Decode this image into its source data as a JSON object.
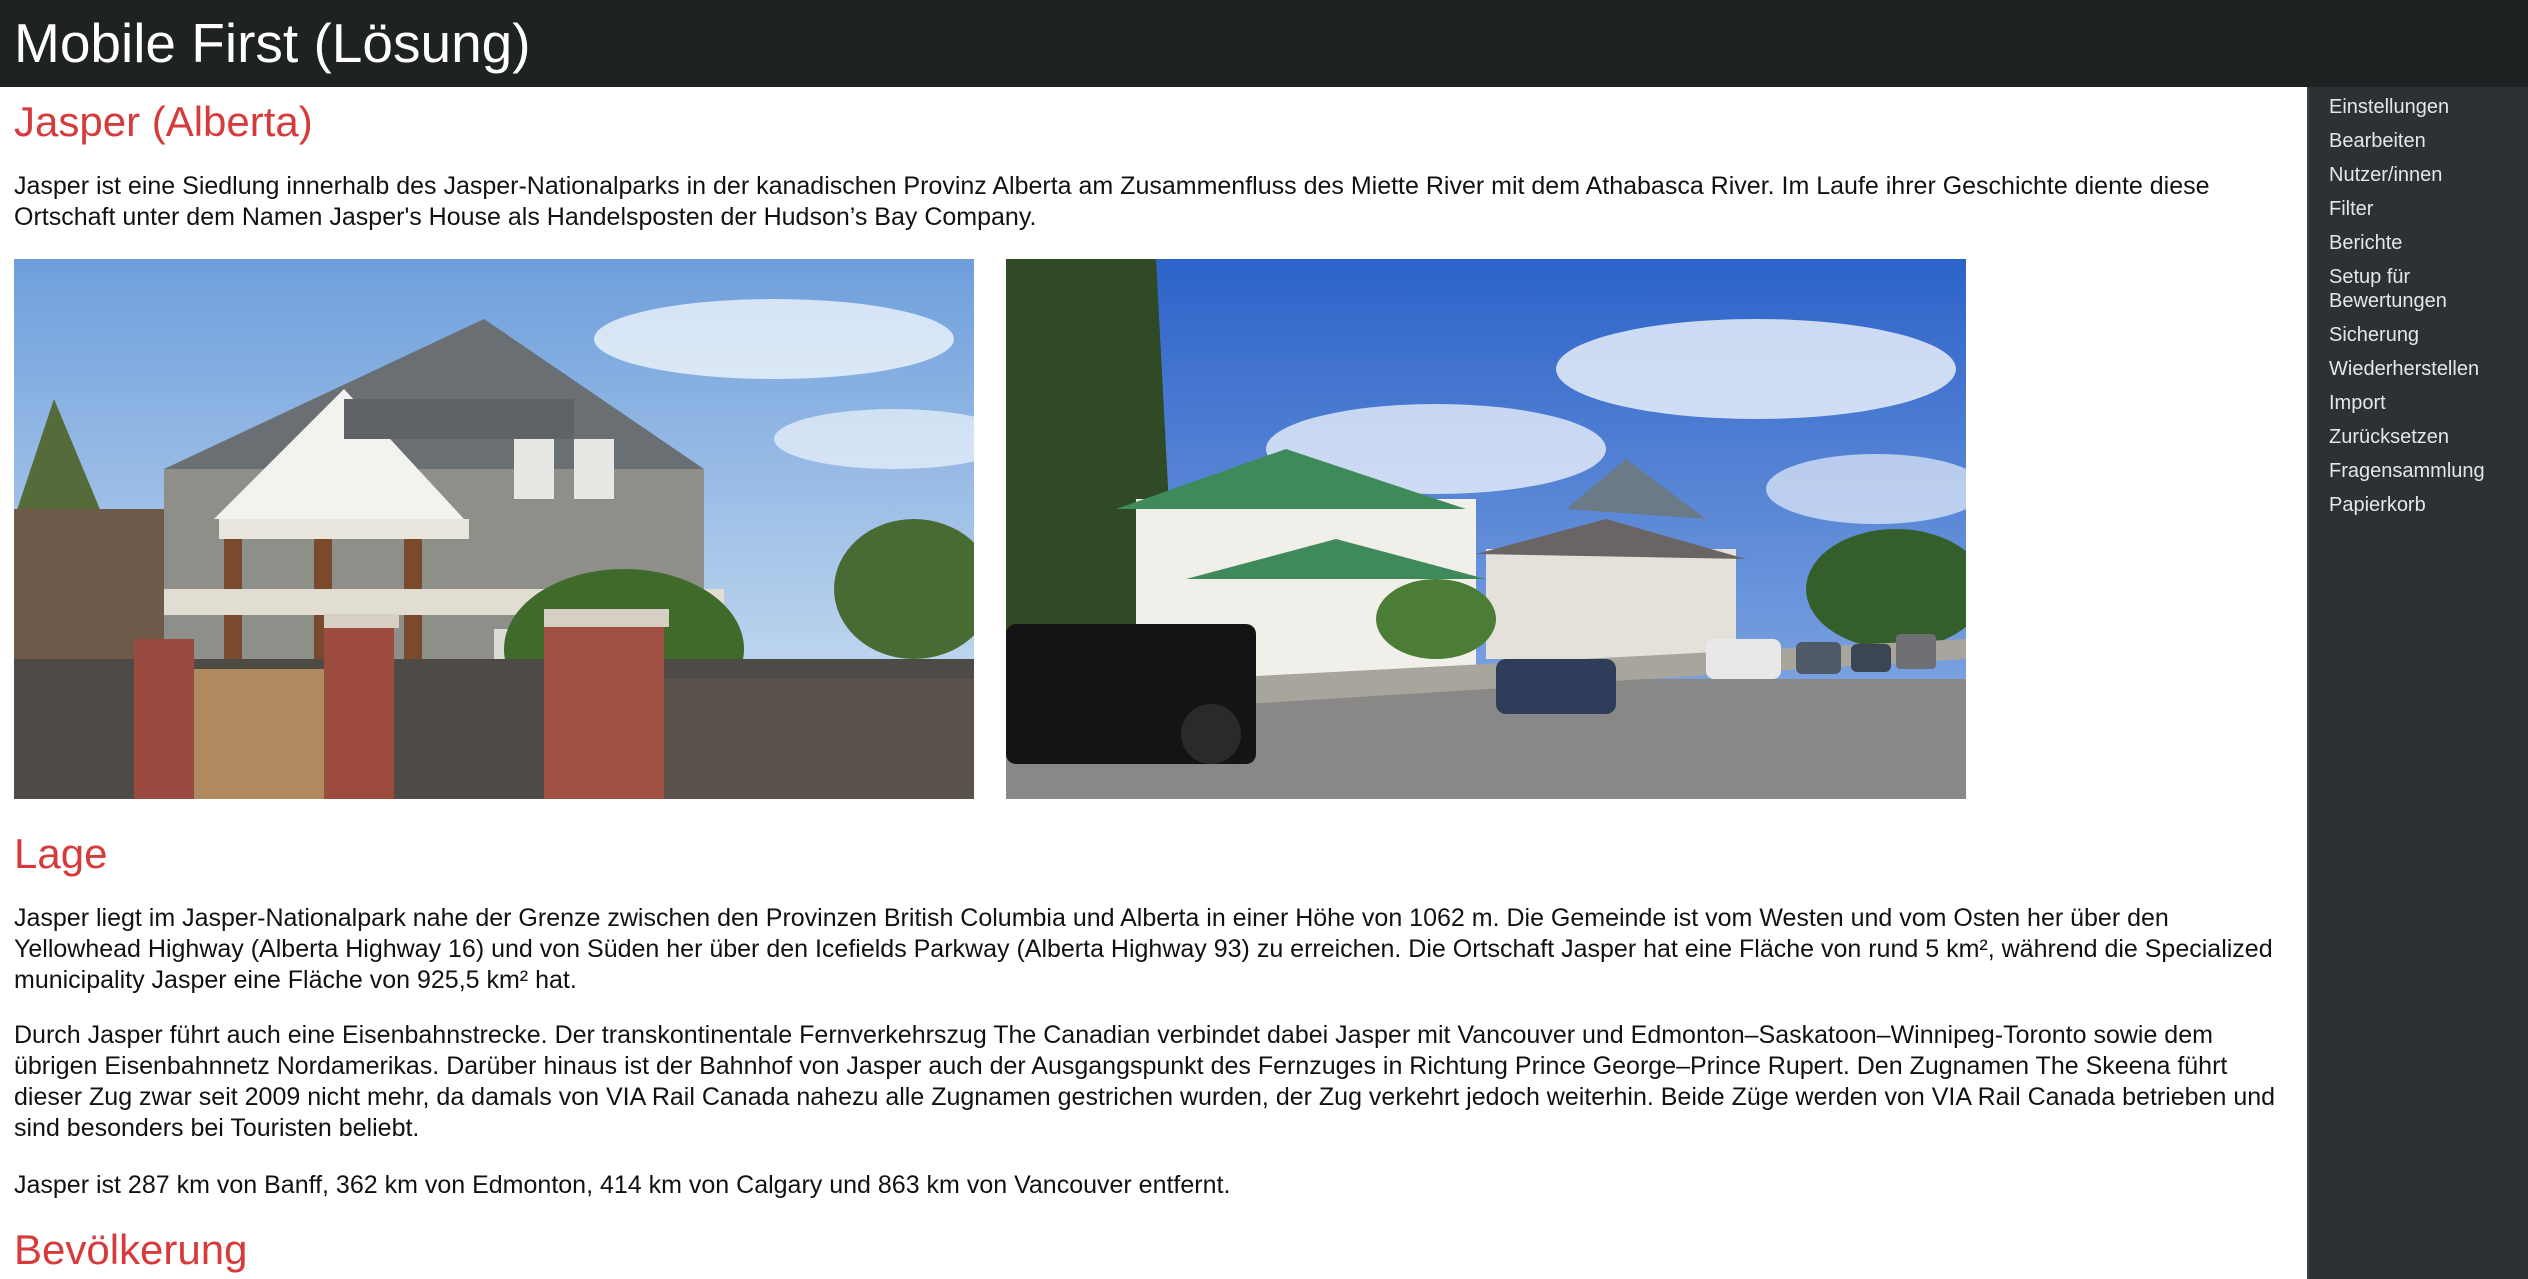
{
  "header": {
    "title": "Mobile First (Lösung)"
  },
  "article": {
    "title": "Jasper (Alberta)",
    "intro": "Jasper ist eine Siedlung innerhalb des Jasper-Nationalparks in der kanadischen Provinz Alberta am Zusammenfluss des Miette River mit dem Athabasca River. Im Laufe ihrer Geschichte diente diese Ortschaft unter dem Namen Jasper's House als Handelsposten der Hudson’s Bay Company.",
    "sections": [
      {
        "heading": "Lage",
        "paragraphs": [
          "Jasper liegt im Jasper-Nationalpark nahe der Grenze zwischen den Provinzen British Columbia und Alberta in einer Höhe von 1062 m. Die Gemeinde ist vom Westen und vom Osten her über den Yellowhead Highway (Alberta Highway 16) und von Süden her über den Icefields Parkway (Alberta Highway 93) zu erreichen. Die Ortschaft Jasper hat eine Fläche von rund 5 km², während die Specialized municipality Jasper eine Fläche von 925,5 km² hat.",
          "Durch Jasper führt auch eine Eisenbahnstrecke. Der transkontinentale Fernverkehrszug The Canadian verbindet dabei Jasper mit Vancouver und Edmonton–Saskatoon–Winnipeg-Toronto sowie dem übrigen Eisenbahnnetz Nordamerikas. Darüber hinaus ist der Bahnhof von Jasper auch der Ausgangspunkt des Fernzuges in Richtung Prince George–Prince Rupert. Den Zugnamen The Skeena führt dieser Zug zwar seit 2009 nicht mehr, da damals von VIA Rail Canada nahezu alle Zugnamen gestrichen wurden, der Zug verkehrt jedoch weiterhin. Beide Züge werden von VIA Rail Canada betrieben und sind besonders bei Touristen beliebt.",
          "Jasper ist 287 km von Banff, 362 km von Edmonton, 414 km von Calgary und 863 km von Vancouver entfernt."
        ]
      },
      {
        "heading": "Bevölkerung"
      }
    ]
  },
  "sidebar": {
    "items": [
      {
        "label": "Einstellungen"
      },
      {
        "label": "Bearbeiten"
      },
      {
        "label": "Nutzer/innen"
      },
      {
        "label": "Filter"
      },
      {
        "label": "Berichte"
      },
      {
        "label": "Setup für Bewertungen"
      },
      {
        "label": "Sicherung"
      },
      {
        "label": "Wiederherstellen"
      },
      {
        "label": "Import"
      },
      {
        "label": "Zurücksetzen"
      },
      {
        "label": "Fragensammlung"
      },
      {
        "label": "Papierkorb"
      }
    ]
  },
  "colors": {
    "header_bg": "#1f2223",
    "heading_accent": "#d63a3a",
    "sidebar_bg": "#2c3234"
  }
}
